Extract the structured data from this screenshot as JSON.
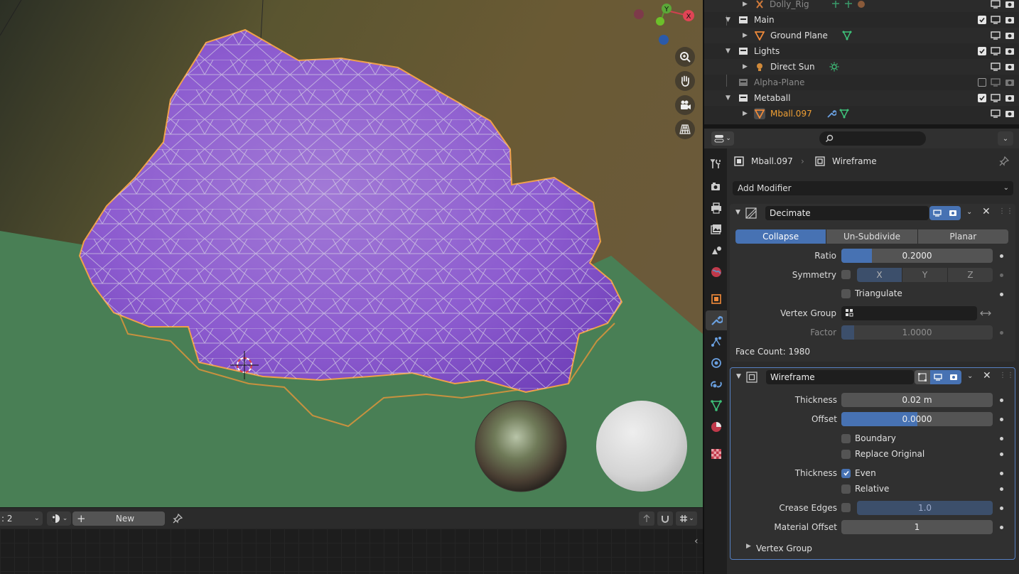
{
  "outliner": {
    "rows": [
      {
        "name": "Dolly_Rig",
        "style": "dim"
      },
      {
        "name": "Main",
        "style": "normal"
      },
      {
        "name": "Ground Plane",
        "style": "normal"
      },
      {
        "name": "Lights",
        "style": "normal"
      },
      {
        "name": "Direct Sun",
        "style": "normal"
      },
      {
        "name": "Alpha-Plane",
        "style": "dim"
      },
      {
        "name": "Metaball",
        "style": "normal"
      },
      {
        "name": "Mball.097",
        "style": "active"
      }
    ]
  },
  "viewport": {
    "gizmo": {
      "x_label": "X",
      "y_label": "Y"
    },
    "colors": {
      "object": "#8a57c9",
      "ground": "#497f55",
      "outline": "#e39b4a",
      "wire": "#d9d9e0"
    }
  },
  "bottom_bar": {
    "slot_label": ": 2",
    "new_label": "New"
  },
  "properties": {
    "breadcrumb": {
      "object": "Mball.097",
      "modifier": "Wireframe"
    },
    "add_modifier": "Add Modifier",
    "decimate": {
      "name": "Decimate",
      "modes": [
        "Collapse",
        "Un-Subdivide",
        "Planar"
      ],
      "selected_mode": "Collapse",
      "ratio_label": "Ratio",
      "ratio_value": "0.2000",
      "ratio_fraction": 0.2,
      "symmetry_label": "Symmetry",
      "axes": [
        "X",
        "Y",
        "Z"
      ],
      "triangulate_label": "Triangulate",
      "vertex_group_label": "Vertex Group",
      "factor_label": "Factor",
      "factor_value": "1.0000",
      "face_count": "Face Count: 1980"
    },
    "wireframe": {
      "name": "Wireframe",
      "thickness_label": "Thickness",
      "thickness_value": "0.02 m",
      "offset_label": "Offset",
      "offset_value": "0.0000",
      "offset_fraction": 0.5,
      "boundary_label": "Boundary",
      "replace_original_label": "Replace Original",
      "thickness2_label": "Thickness",
      "even_label": "Even",
      "relative_label": "Relative",
      "crease_edges_label": "Crease Edges",
      "crease_value": "1.0",
      "material_offset_label": "Material Offset",
      "material_offset_value": "1",
      "vertex_group_sub": "Vertex Group"
    }
  }
}
